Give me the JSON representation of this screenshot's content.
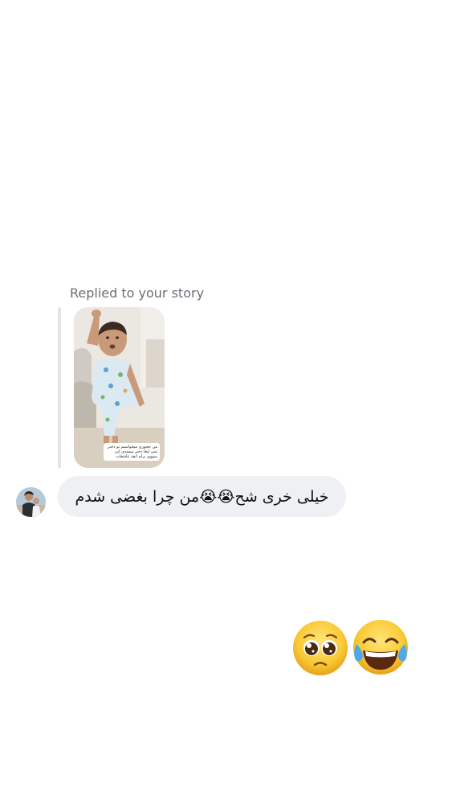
{
  "reply": {
    "caption": "Replied to your story",
    "story_overlay_lines": [
      "من چجوری میخواستم تو دختر",
      "شی لبغا دختر میشدی این",
      "منووی برام انقد عاشقات"
    ]
  },
  "message": {
    "text": "خیلی خری شح😭😭من چرا بغضی شدم"
  },
  "reactions": [
    {
      "icon": "pleading-face-icon",
      "char": "🥺"
    },
    {
      "icon": "face-with-tears-of-joy-icon",
      "char": "😂"
    }
  ],
  "colors": {
    "bubble": "#eef0f3",
    "caption": "#6b6f76",
    "reply_bar": "#e2e4e8",
    "emoji_yellow": "#f9c934",
    "emoji_tear_blue": "#4fa8e8"
  }
}
